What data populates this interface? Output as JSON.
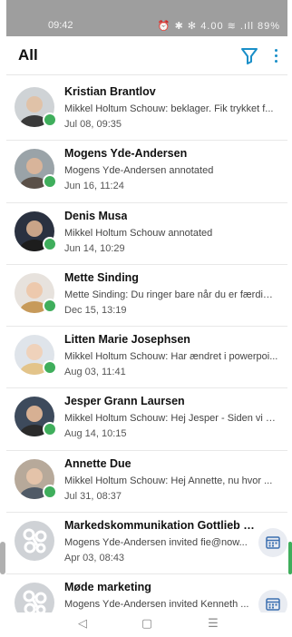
{
  "status_bar": {
    "time": "09:42",
    "icons_text": "⏰ ✱ ✻ 4.00 ≋ .ıll 89%"
  },
  "header": {
    "title": "All",
    "filter_icon": "filter-icon",
    "more_icon": "more-vert-icon",
    "accent_color": "#1a8fc8"
  },
  "conversations": [
    {
      "name": "Kristian Brantlov",
      "message": "Mikkel Holtum Schouw: beklager. Fik trykket f...",
      "date": "Jul 08, 09:35",
      "presence": true
    },
    {
      "name": "Mogens Yde-Andersen",
      "message": "Mogens Yde-Andersen annotated",
      "date": "Jun 16, 11:24",
      "presence": true
    },
    {
      "name": "Denis Musa",
      "message": "Mikkel Holtum Schouw annotated",
      "date": "Jun 14, 10:29",
      "presence": true
    },
    {
      "name": "Mette Sinding",
      "message": "Mette Sinding: Du ringer bare når du er færdig ...",
      "date": "Dec 15, 13:19",
      "presence": true
    },
    {
      "name": "Litten Marie Josephsen",
      "message": "Mikkel Holtum Schouw: Har ændret i powerpoi...",
      "date": "Aug 03, 11:41",
      "presence": true
    },
    {
      "name": "Jesper Grann Laursen",
      "message": "Mikkel Holtum Schouw: Hej Jesper - Siden vi o...",
      "date": "Aug 14, 10:15",
      "presence": true
    },
    {
      "name": "Annette Due",
      "message": "Mikkel Holtum Schouw: Hej Annette, nu hvor ...",
      "date": "Jul 31, 08:37",
      "presence": true
    },
    {
      "name": "Markedskommunikation Gottlieb &...",
      "message": "Mogens Yde-Andersen invited fie@now...",
      "date": "Apr 03, 08:43",
      "group": true
    },
    {
      "name": "Møde marketing",
      "message": "Mogens Yde-Andersen invited Kenneth ...",
      "date": "Mar 28, 08:52",
      "group": true
    }
  ],
  "presence_color": "#3fae5c",
  "nav_bar": {
    "back": "◁",
    "home": "▢",
    "recents": "☰"
  }
}
